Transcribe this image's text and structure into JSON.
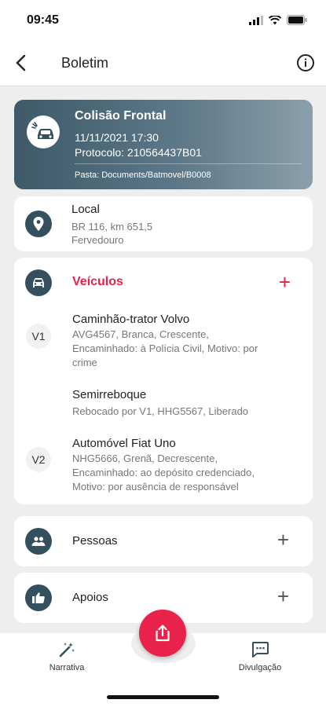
{
  "status_bar": {
    "time": "09:45"
  },
  "header": {
    "title": "Boletim"
  },
  "occurrence": {
    "title": "Colisão Frontal",
    "datetime": "11/11/2021 17:30",
    "protocol": "Protocolo: 210564437B01",
    "folder": "Pasta: Documents/Batmovel/B0008"
  },
  "local": {
    "label": "Local",
    "address": "BR 116, km 651,5",
    "city": "Fervedouro"
  },
  "vehicles": {
    "label": "Veículos",
    "add_symbol": "+",
    "items": [
      {
        "badge": "V1",
        "title": "Caminhão-trator Volvo",
        "lines": [
          "AVG4567, Branca, Crescente,",
          "Encaminhado: à Polícia Civil, Motivo: por",
          "crime"
        ]
      },
      {
        "badge": "",
        "title": "Semirreboque",
        "lines": [
          "Rebocado por V1, HHG5567, Liberado"
        ]
      },
      {
        "badge": "V2",
        "title": "Automóvel Fiat Uno",
        "lines": [
          "NHG5666, Grenã, Decrescente,",
          "Encaminhado: ao depósito credenciado,",
          "Motivo: por ausência de responsável"
        ]
      }
    ]
  },
  "people": {
    "label": "Pessoas",
    "add_symbol": "+"
  },
  "supports": {
    "label": "Apoios",
    "add_symbol": "+"
  },
  "bottom_nav": {
    "left": {
      "label": "Narrativa",
      "icon": "magic-wand-icon"
    },
    "right": {
      "label": "Divulgação",
      "icon": "chat-icon"
    },
    "fab_icon": "share-icon"
  },
  "colors": {
    "accent": "#e8224a",
    "icon_bg": "#34505f",
    "hero_start": "#3d5a69",
    "hero_end": "#8a9fab"
  }
}
